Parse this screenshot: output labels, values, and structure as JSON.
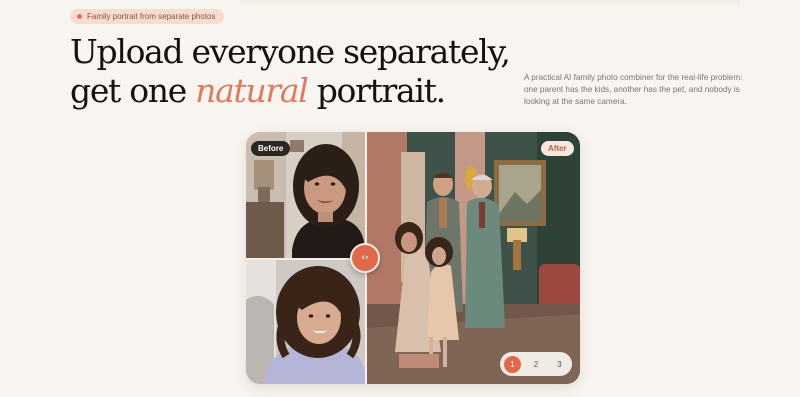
{
  "hero": {
    "eyebrow": "Family portrait from separate photos",
    "headline_line1": "Upload everyone separately,",
    "headline_line2_before": "get one ",
    "headline_accent": "natural",
    "headline_line2_after": " portrait.",
    "description": "A practical AI family photo combiner for the real-life problem: one parent has the kids, another has the pet, and nobody is looking at the same camera."
  },
  "comparison": {
    "before_label": "Before",
    "after_label": "After",
    "handle_glyph": "‹›",
    "pagination": [
      "1",
      "2",
      "3"
    ],
    "active_page": "1"
  },
  "icons": {
    "eyebrow_dot": "dot-icon",
    "handle": "chevron-left-right-icon"
  },
  "colors": {
    "background": "#f8f4ef",
    "accent": "#e07a5f",
    "handle": "#e2684a",
    "eyebrow_bg": "#f7dcd0"
  }
}
